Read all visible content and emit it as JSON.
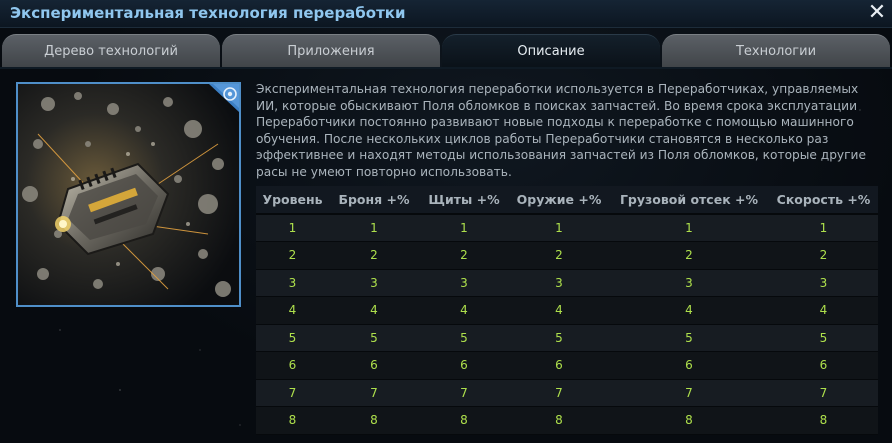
{
  "window": {
    "title": "Экспериментальная технология переработки",
    "close_symbol": "✕"
  },
  "tabs": [
    {
      "label": "Дерево технологий",
      "active": false
    },
    {
      "label": "Приложения",
      "active": false
    },
    {
      "label": "Описание",
      "active": true
    },
    {
      "label": "Технологии",
      "active": false
    }
  ],
  "description": "Экспериментальная технология переработки используется в Переработчиках, управляемых ИИ, которые обыскивают Поля обломков в поисках запчастей. Во время срока эксплуатации Переработчики постоянно развивают новые подходы к переработке с помощью машинного обучения. После нескольких циклов работы Переработчики становятся в несколько раз эффективнее и находят методы использования запчастей из Поля обломков, которые другие расы не умеют повторно использовать.",
  "image": {
    "icon": "recycler-ship-image",
    "badge_icon": "faction-badge-icon"
  },
  "table": {
    "headers": [
      "Уровень",
      "Броня +%",
      "Щиты +%",
      "Оружие +%",
      "Грузовой отсек +%",
      "Скорость +%"
    ],
    "rows": [
      [
        "1",
        "1",
        "1",
        "1",
        "1",
        "1"
      ],
      [
        "2",
        "2",
        "2",
        "2",
        "2",
        "2"
      ],
      [
        "3",
        "3",
        "3",
        "3",
        "3",
        "3"
      ],
      [
        "4",
        "4",
        "4",
        "4",
        "4",
        "4"
      ],
      [
        "5",
        "5",
        "5",
        "5",
        "5",
        "5"
      ],
      [
        "6",
        "6",
        "6",
        "6",
        "6",
        "6"
      ],
      [
        "7",
        "7",
        "7",
        "7",
        "7",
        "7"
      ],
      [
        "8",
        "8",
        "8",
        "8",
        "8",
        "8"
      ]
    ]
  },
  "colors": {
    "title": "#8fc6ee",
    "value_green": "#aee04c",
    "frame_blue": "#4f8fc9"
  }
}
